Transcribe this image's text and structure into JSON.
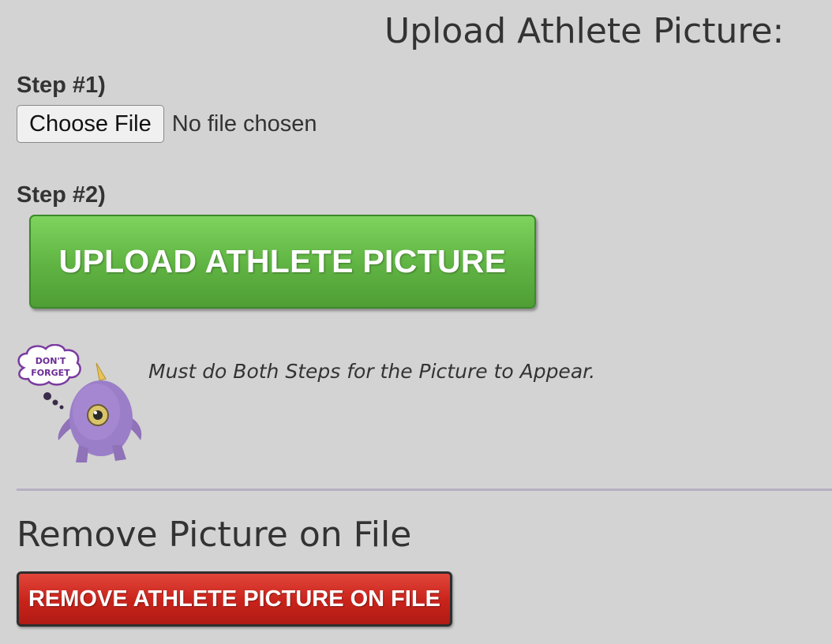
{
  "upload_section": {
    "title": "Upload Athlete Picture:",
    "step1_label": "Step #1)",
    "choose_file_label": "Choose File",
    "file_status": "No file chosen",
    "step2_label": "Step #2)",
    "upload_button_label": "UPLOAD ATHLETE PICTURE",
    "upload_button_color": "#5fb342",
    "reminder_text": "Must do Both Steps for the Picture to Appear.",
    "mascot": {
      "icon": "purple-monster-mascot",
      "bubble_text_line1": "DON'T",
      "bubble_text_line2": "FORGET"
    }
  },
  "remove_section": {
    "title": "Remove Picture on File",
    "remove_button_label": "REMOVE ATHLETE PICTURE ON FILE",
    "remove_button_color": "#c8231b"
  }
}
